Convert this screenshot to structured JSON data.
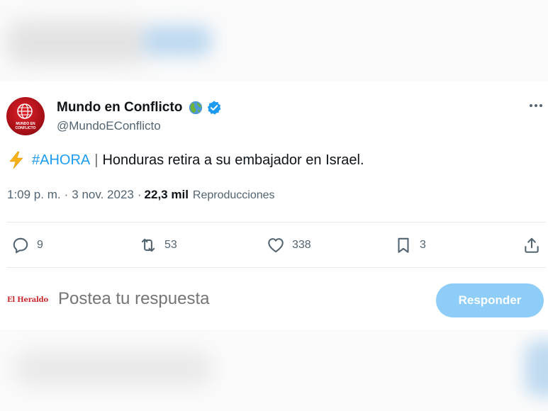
{
  "tweet": {
    "display_name": "Mundo en Conflicto",
    "handle": "@MundoEConflicto",
    "avatar_text": "MUNDO EN CONFLICTO",
    "text": {
      "emoji": "⚡",
      "hashtag": "#AHORA",
      "separator": "|",
      "body": "Honduras retira a su embajador en Israel."
    },
    "meta": {
      "time": "1:09 p. m.",
      "dot1": "·",
      "date": "3 nov. 2023",
      "dot2": "·",
      "views_count": "22,3 mil",
      "views_label": "Reproducciones"
    },
    "actions": {
      "replies": "9",
      "reposts": "53",
      "likes": "338",
      "bookmarks": "3"
    },
    "colors": {
      "accent": "#1d9bf0",
      "text": "#0f1419",
      "muted": "#536471",
      "reply_button": "#8ecdf8"
    }
  },
  "reply": {
    "avatar_label": "El Heraldo",
    "placeholder": "Postea tu respuesta",
    "button_label": "Responder"
  }
}
